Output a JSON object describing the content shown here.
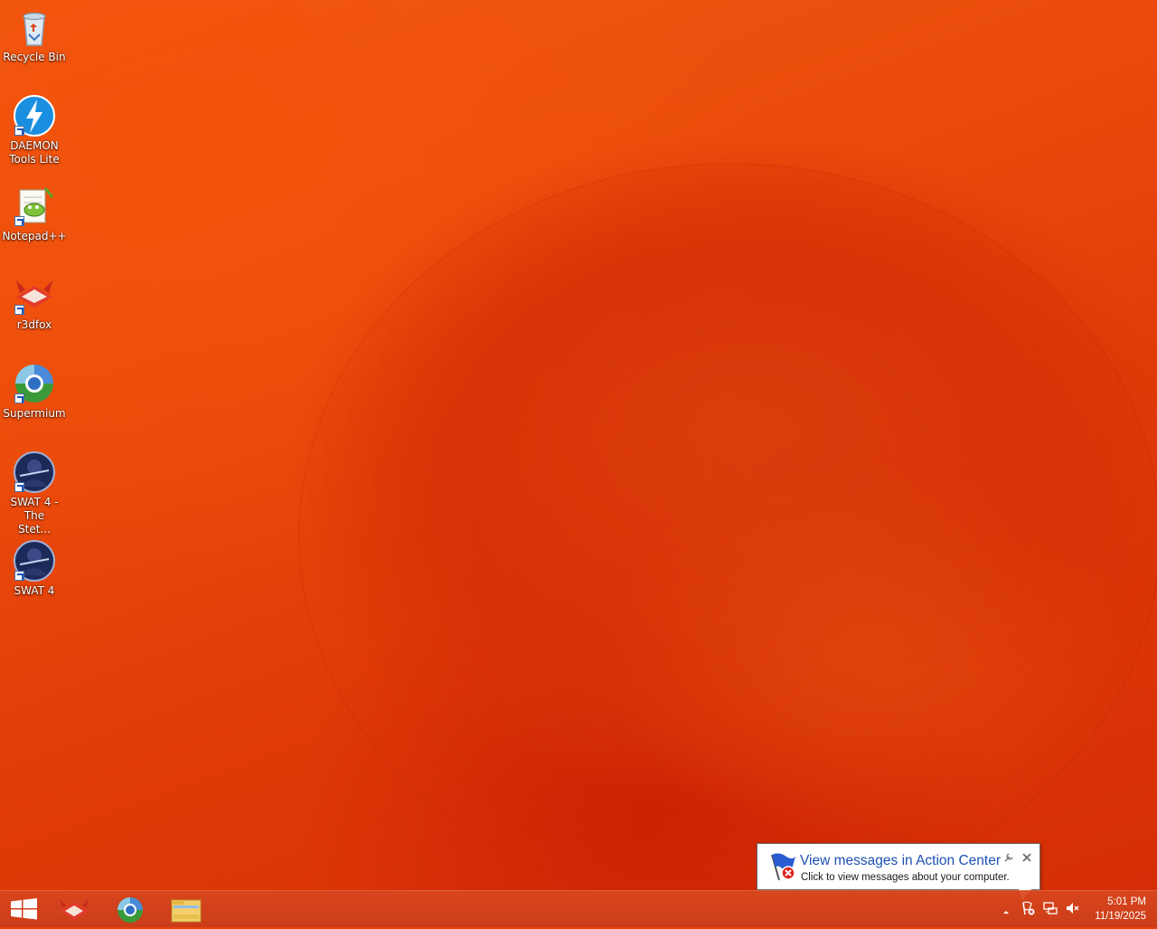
{
  "desktop": {
    "icons": [
      {
        "label": "Recycle Bin",
        "icon": "recycle-bin-icon"
      },
      {
        "label": "DAEMON Tools Lite",
        "icon": "daemon-tools-icon"
      },
      {
        "label": "Notepad++",
        "icon": "notepadpp-icon"
      },
      {
        "label": "r3dfox",
        "icon": "r3dfox-icon"
      },
      {
        "label": "Supermium",
        "icon": "supermium-icon"
      },
      {
        "label": "SWAT 4 - The Stet...",
        "icon": "swat4-stetchkov-icon"
      },
      {
        "label": "SWAT 4",
        "icon": "swat4-icon"
      }
    ]
  },
  "taskbar": {
    "pinned": [
      {
        "name": "r3dfox",
        "icon": "r3dfox-icon"
      },
      {
        "name": "Supermium",
        "icon": "supermium-icon"
      },
      {
        "name": "File Explorer",
        "icon": "file-explorer-icon"
      }
    ],
    "tray": {
      "time": "5:01 PM",
      "date": "11/19/2025"
    }
  },
  "notification": {
    "title": "View messages in Action Center",
    "text": "Click to view messages about your computer.",
    "icon": "action-center-flag-icon"
  },
  "colors": {
    "wallpaper": "#e8410a",
    "balloon_title": "#1e50b4"
  }
}
